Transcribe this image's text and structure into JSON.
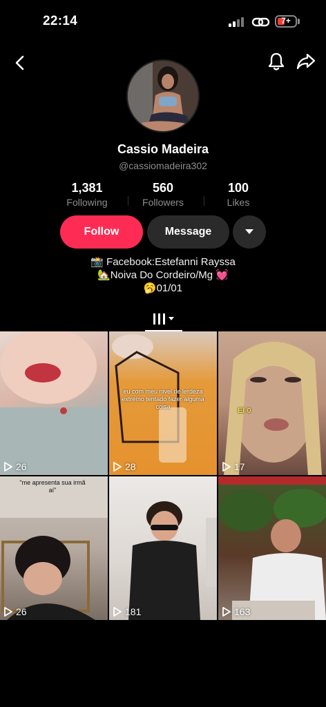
{
  "status": {
    "time": "22:14",
    "battery": "7+"
  },
  "profile": {
    "display_name": "Cassio Madeira",
    "username": "@cassiomadeira302",
    "stats": [
      {
        "value": "1,381",
        "label": "Following"
      },
      {
        "value": "560",
        "label": "Followers"
      },
      {
        "value": "100",
        "label": "Likes"
      }
    ],
    "follow_label": "Follow",
    "message_label": "Message",
    "bio": [
      "📸 Facebook:Estefanni Rayssa",
      "🏡Noiva Do Cordeiro/Mg 💓",
      "🥱01/01"
    ]
  },
  "videos": [
    {
      "views": "26"
    },
    {
      "views": "28",
      "caption": "eu com meu nivel de lerdeza extremo tentado fazer alguma coisa"
    },
    {
      "views": "17",
      "caption": "El 0"
    },
    {
      "views": "26",
      "caption": "\"me apresenta sua irmã aí\""
    },
    {
      "views": "181"
    },
    {
      "views": "163"
    }
  ],
  "colors": {
    "accent": "#fe2c55",
    "secondary_button": "#2a2a2a",
    "muted_text": "#8e8e8e"
  }
}
